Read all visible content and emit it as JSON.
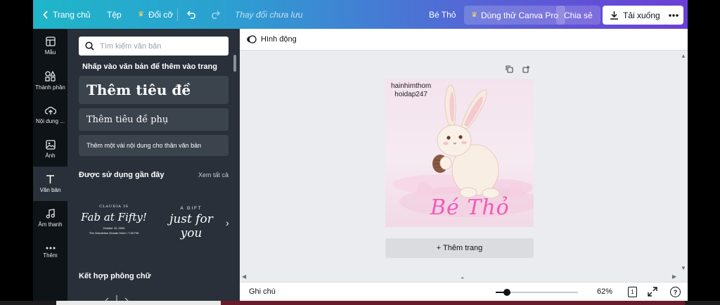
{
  "topbar": {
    "back_label": "Trang chủ",
    "file_label": "Tệp",
    "resize_label": "Đổi cỡ",
    "save_status": "Thay đổi chưa lưu",
    "design_name": "Bé Thỏ",
    "try_pro_label": "Dùng thử Canva Pro",
    "share_label": "Chia sẻ",
    "download_label": "Tải xuống"
  },
  "sidebar": {
    "items": [
      {
        "label": "Mẫu",
        "icon": "template-icon"
      },
      {
        "label": "Thành phần",
        "icon": "elements-icon"
      },
      {
        "label": "Nội dung ...",
        "icon": "upload-icon"
      },
      {
        "label": "Ảnh",
        "icon": "photo-icon"
      },
      {
        "label": "Văn bản",
        "icon": "text-icon"
      },
      {
        "label": "Âm thanh",
        "icon": "music-icon"
      },
      {
        "label": "Thêm",
        "icon": "more-icon"
      }
    ]
  },
  "text_panel": {
    "search_placeholder": "Tìm kiếm văn bản",
    "heading": "Nhấp vào văn bản để thêm vào trang",
    "add_heading": "Thêm tiêu đề",
    "add_subheading": "Thêm tiêu đề phụ",
    "add_body": "Thêm một vài nội dung cho thân văn bản",
    "recent_title": "Được sử dụng gần đây",
    "see_all": "Xem tất cả",
    "recent_1": {
      "line1": "CLAUDIA IS",
      "line2": "Fab at Fifty!",
      "line3": "October 10, 2000",
      "line4": "The Grandview Grands Hotel • 7:00 PM"
    },
    "recent_2": {
      "line1": "A GIFT",
      "line2": "just for you"
    },
    "combo_title": "Kết hợp phông chữ"
  },
  "editor": {
    "animate_label": "Hình động",
    "design_watermark_1": "hainhimthom",
    "design_watermark_2": "hoidap247",
    "design_title": "Bé Thỏ",
    "add_page_label": "+ Thêm trang",
    "notes_label": "Ghi chú",
    "zoom_value": "62%",
    "zoom_fraction": 0.1,
    "page_number": "1"
  },
  "colors": {
    "accent_pink": "#f25ab8",
    "dark_panel": "#293039",
    "nav_bg": "#0e1318"
  }
}
